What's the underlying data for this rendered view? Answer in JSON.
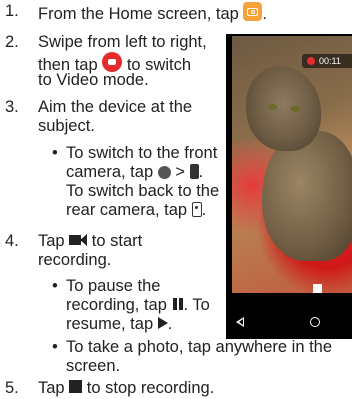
{
  "steps": [
    {
      "number": "1.",
      "text_before": "From the Home screen, tap",
      "text_after": "."
    },
    {
      "number": "2.",
      "line1": "Swipe from left to right,",
      "line2_before": "then tap",
      "line2_after": "to switch",
      "line3": "to Video mode."
    },
    {
      "number": "3.",
      "line1": "Aim the device at the",
      "line2": "subject."
    },
    {
      "number": "4.",
      "line1_before": "Tap",
      "line1_after": "to start",
      "line2": "recording."
    },
    {
      "number": "5.",
      "text_before": "Tap",
      "text_after": "to stop recording."
    }
  ],
  "bullets": {
    "switch_camera": {
      "line1": "To switch to the front",
      "line2_before": "camera, tap",
      "line2_mid": ">",
      "line2_after": ".",
      "line3": "To switch back to the",
      "line4_before": "rear camera, tap",
      "line4_after": "."
    },
    "pause": {
      "line1": "To pause the",
      "line2": "recording, tap",
      "line2_after": ". To",
      "line3_before": "resume, tap",
      "line3_after": "."
    },
    "photo": {
      "line1": "To take a photo, tap anywhere in the",
      "line2": "screen."
    },
    "bullet_char": "•"
  },
  "phone_screenshot": {
    "recording_time": "00:11"
  },
  "icons": {
    "camera": "camera-app-icon",
    "record": "record-toggle-icon",
    "switch": "switch-camera-icon",
    "front": "front-camera-icon",
    "rear": "rear-camera-icon",
    "video": "video-record-icon",
    "pause": "pause-icon",
    "play": "resume-icon",
    "stop": "stop-icon"
  },
  "colors": {
    "camera_icon": "#f6a23a",
    "record_red": "#e52b2b",
    "text": "#222222"
  }
}
